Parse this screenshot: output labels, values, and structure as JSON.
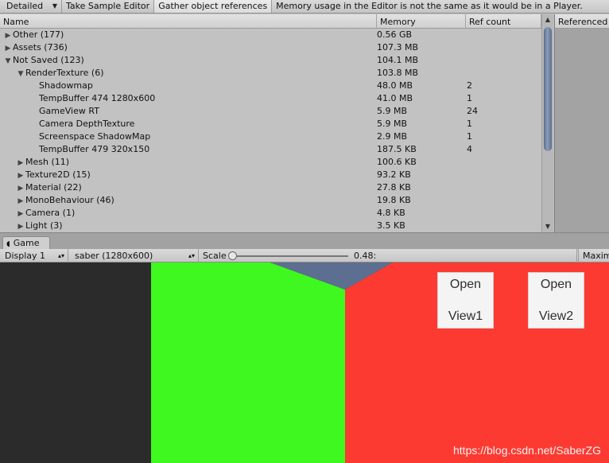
{
  "toolbar": {
    "mode_label": "Detailed",
    "take_sample_label": "Take Sample Editor",
    "gather_refs_label": "Gather object references",
    "notice": "Memory usage in the Editor is not the same as it would be in a Player."
  },
  "table": {
    "columns": {
      "name": "Name",
      "memory": "Memory",
      "ref_count": "Ref count"
    },
    "rows": [
      {
        "name": "Other (177)",
        "memory": "0.56 GB",
        "ref": ""
      },
      {
        "name": "Assets (736)",
        "memory": "107.3 MB",
        "ref": ""
      },
      {
        "name": "Not Saved (123)",
        "memory": "104.1 MB",
        "ref": ""
      },
      {
        "name": "RenderTexture (6)",
        "memory": "103.8 MB",
        "ref": ""
      },
      {
        "name": "Shadowmap",
        "memory": "48.0 MB",
        "ref": "2"
      },
      {
        "name": "TempBuffer 474 1280x600",
        "memory": "41.0 MB",
        "ref": "1"
      },
      {
        "name": "GameView RT",
        "memory": "5.9 MB",
        "ref": "24"
      },
      {
        "name": "Camera DepthTexture",
        "memory": "5.9 MB",
        "ref": "1"
      },
      {
        "name": "Screenspace ShadowMap",
        "memory": "2.9 MB",
        "ref": "1"
      },
      {
        "name": "TempBuffer 479 320x150",
        "memory": "187.5 KB",
        "ref": "4"
      },
      {
        "name": "Mesh (11)",
        "memory": "100.6 KB",
        "ref": ""
      },
      {
        "name": "Texture2D (15)",
        "memory": "93.2 KB",
        "ref": ""
      },
      {
        "name": "Material (22)",
        "memory": "27.8 KB",
        "ref": ""
      },
      {
        "name": "MonoBehaviour (46)",
        "memory": "19.8 KB",
        "ref": ""
      },
      {
        "name": "Camera (1)",
        "memory": "4.8 KB",
        "ref": ""
      },
      {
        "name": "Light (3)",
        "memory": "3.5 KB",
        "ref": ""
      }
    ]
  },
  "referenced_panel": {
    "header": "Referenced"
  },
  "game": {
    "tab_label": "Game",
    "display_label": "Display 1",
    "resolution_label": "saber (1280x600)",
    "scale_label": "Scale",
    "scale_value": "0.48:",
    "maximize_label": "Maxim",
    "buttons": [
      {
        "line1": "Open",
        "line2": "View1"
      },
      {
        "line1": "Open",
        "line2": "View2"
      }
    ],
    "watermark": "https://blog.csdn.net/SaberZG",
    "colors": {
      "dark": "#2b2b2b",
      "green": "#3ff81f",
      "red": "#fd3a31",
      "sky": "#5d6f90"
    }
  }
}
